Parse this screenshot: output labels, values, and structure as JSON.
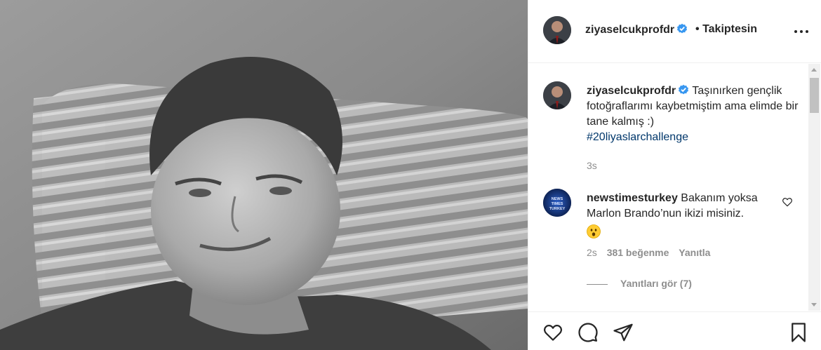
{
  "post": {
    "author": "ziyaselcukprofdr",
    "follow_separator": "•",
    "follow_status": "Takiptesin",
    "more_icon": "more-horizontal-icon",
    "verified_icon": "verified-badge-icon",
    "photo_description_icon": "photo",
    "caption": {
      "username": "ziyaselcukprofdr",
      "text": "Taşınırken gençlik fotoğraflarımı kaybetmiştim ama elimde bir tane kalmış :)",
      "hashtag": "#20liyaslarchallenge",
      "time": "3s"
    }
  },
  "comments": [
    {
      "username": "newstimesturkey",
      "text": "Bakanım yoksa Marlon Brando’nun ikizi misiniz.",
      "emoji": "astonished-face-emoji",
      "time": "2s",
      "likes": "381 beğenme",
      "reply_label": "Yanıtla",
      "view_replies": "Yanıtları gör (7)",
      "avatar_text": "NEWS TIMES TURKEY"
    }
  ],
  "actions": {
    "like_icon": "heart-icon",
    "comment_icon": "comment-icon",
    "share_icon": "paper-plane-icon",
    "save_icon": "bookmark-icon"
  },
  "colors": {
    "text": "#262626",
    "muted": "#8e8e8e",
    "link": "#00376b",
    "verified": "#3897f0",
    "divider": "#efefef"
  }
}
